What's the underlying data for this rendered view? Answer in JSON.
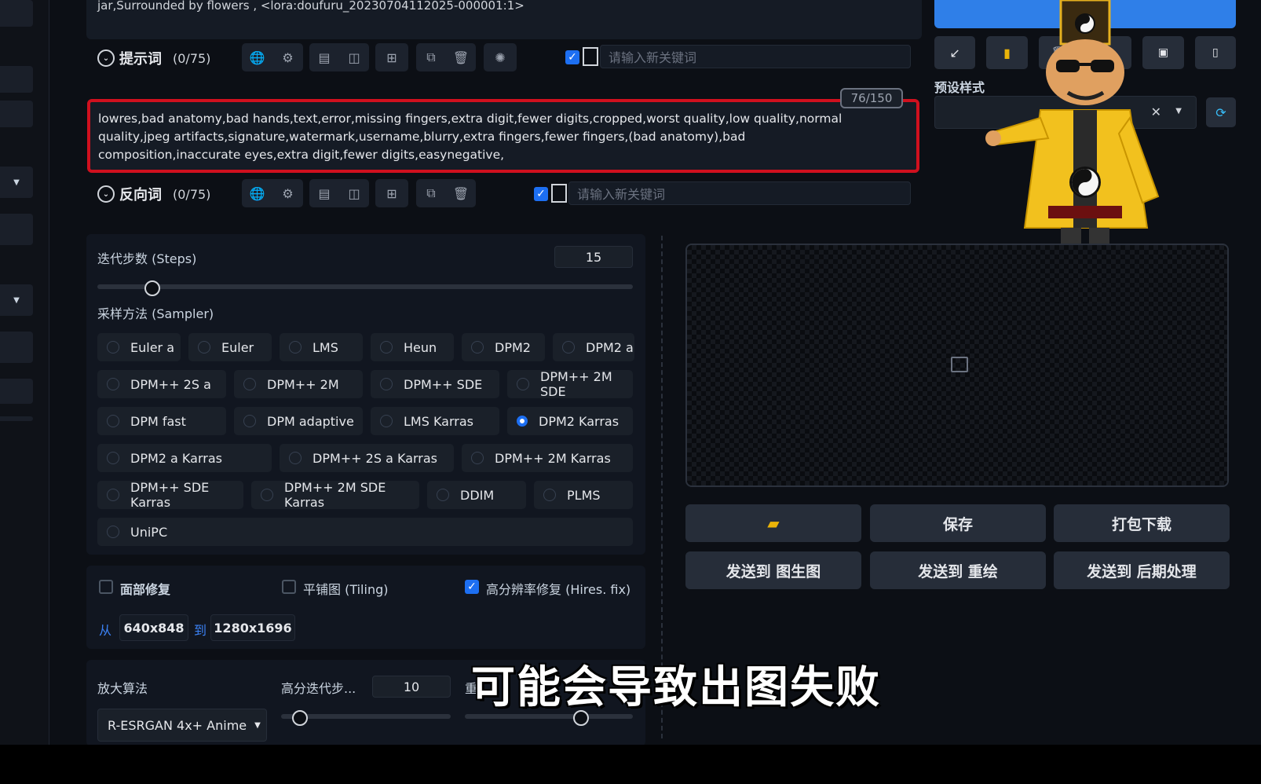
{
  "prompt_tail": "jar,Surrounded by flowers , <lora:doufuru_20230704112025-000001:1>",
  "positive": {
    "label": "提示词",
    "count": "(0/75)",
    "keyword_placeholder": "请输入新关键词"
  },
  "negative": {
    "label": "反向词",
    "count": "(0/75)",
    "keyword_placeholder": "请输入新关键词",
    "token_counter": "76/150",
    "text": "lowres,bad anatomy,bad hands,text,error,missing fingers,extra digit,fewer digits,cropped,worst quality,low quality,normal quality,jpeg artifacts,signature,watermark,username,blurry,extra fingers,fewer fingers,(bad anatomy),bad composition,inaccurate eyes,extra digit,fewer digits,easynegative,"
  },
  "steps": {
    "label": "迭代步数 (Steps)",
    "value": "15",
    "slider_fraction": 0.1
  },
  "sampler": {
    "label": "采样方法 (Sampler)",
    "selected": "DPM2 Karras",
    "options": [
      "Euler a",
      "Euler",
      "LMS",
      "Heun",
      "DPM2",
      "DPM2 a",
      "DPM++ 2S a",
      "DPM++ 2M",
      "DPM++ SDE",
      "DPM++ 2M SDE",
      "DPM fast",
      "DPM adaptive",
      "LMS Karras",
      "DPM2 Karras",
      "DPM2 a Karras",
      "DPM++ 2S a Karras",
      "DPM++ 2M Karras",
      "DPM++ SDE Karras",
      "DPM++ 2M SDE Karras",
      "DDIM",
      "PLMS",
      "UniPC"
    ]
  },
  "options": {
    "face_restore": "面部修复",
    "tiling": "平铺图 (Tiling)",
    "hires_fix": "高分辨率修复 (Hires. fix)"
  },
  "resize": {
    "from_label": "从",
    "from": "640x848",
    "to_label": "到",
    "to": "1280x1696"
  },
  "upscaler": {
    "label": "放大算法",
    "value": "R-ESRGAN 4x+ Anime"
  },
  "hires_steps": {
    "label": "高分迭代步...",
    "value": "10"
  },
  "denoise": {
    "label": "重"
  },
  "styles": {
    "label": "预设样式"
  },
  "actions": {
    "save": "保存",
    "zip": "打包下载",
    "send_img2img": "发送到 图生图",
    "send_inpaint": "发送到 重绘",
    "send_extras": "发送到 后期处理"
  },
  "subtitle": "可能会导致出图失败",
  "colors": {
    "accent": "#1d6ff2",
    "highlight_border": "#d0101e",
    "generate_button": "#2f7fe8"
  }
}
